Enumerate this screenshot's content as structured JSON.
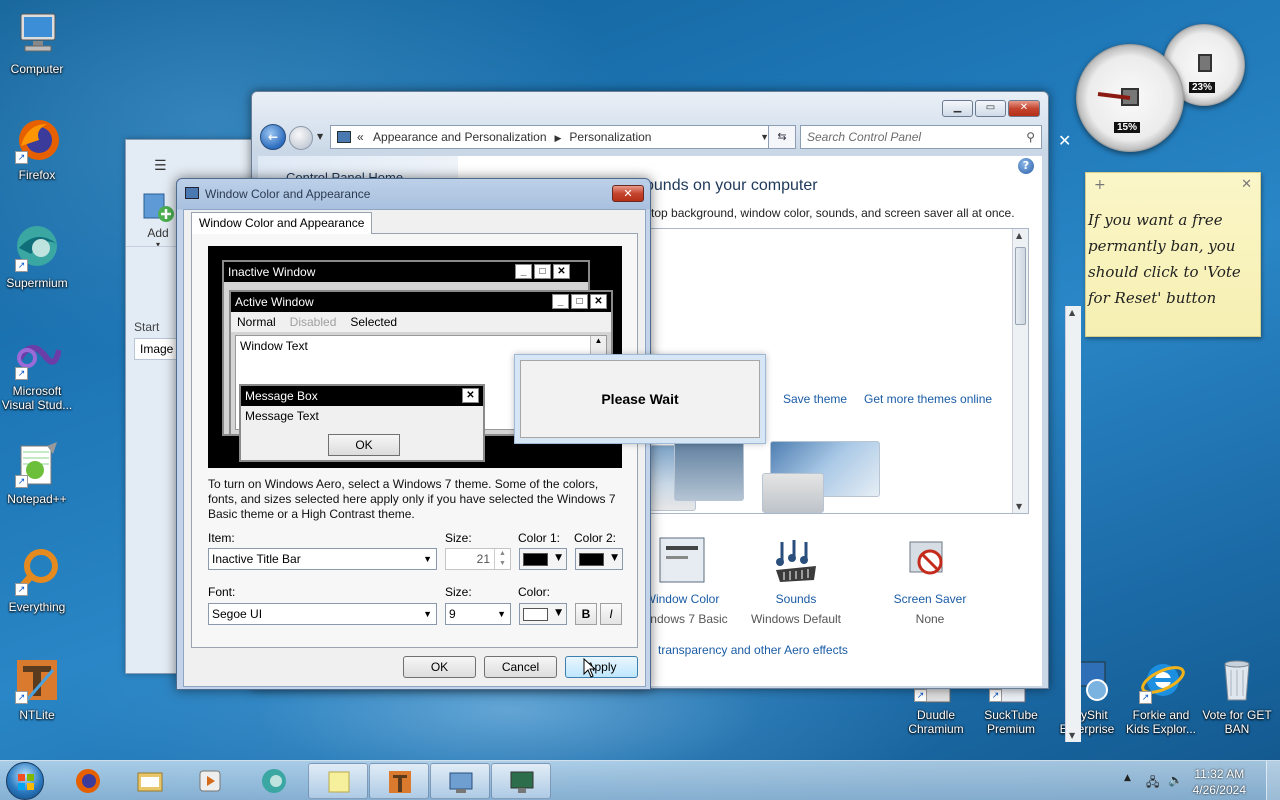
{
  "desktop": {
    "icons_left": [
      {
        "label": "Computer"
      },
      {
        "label": "Firefox"
      },
      {
        "label": "Supermium"
      },
      {
        "label": "Microsoft Visual Stud..."
      },
      {
        "label": "Notepad++"
      },
      {
        "label": "Everything"
      },
      {
        "label": "NTLite"
      }
    ],
    "icons_bottom": [
      {
        "label": "Duudle Chramium"
      },
      {
        "label": "SuckTube Premium"
      },
      {
        "label": "AnyShit Enterprise"
      },
      {
        "label": "Forkie and Kids Explor..."
      },
      {
        "label": "Vote for GET BAN"
      }
    ]
  },
  "back_window": {
    "menu_icon": "hamburger-icon",
    "add_label": "Add",
    "start_label": "Start",
    "image_label": "Image"
  },
  "explorer": {
    "address": {
      "prefix": "«",
      "crumb1": "Appearance and Personalization",
      "crumb2": "Personalization"
    },
    "search_placeholder": "Search Control Panel",
    "left_title": "Control Panel Home",
    "heading": "ounds on your computer",
    "subheading": "ktop background, window color, sounds, and screen saver all at once.",
    "save_theme": "Save theme",
    "more_themes": "Get more themes online",
    "items": [
      {
        "title": "Window Color",
        "sub": "Windows 7 Basic"
      },
      {
        "title": "Sounds",
        "sub": "Windows Default"
      },
      {
        "title": "Screen Saver",
        "sub": "None"
      }
    ],
    "aero_link": "transparency and other Aero effects",
    "close_x": "✕"
  },
  "dialog": {
    "title": "Window Color and Appearance",
    "tab": "Window Color and Appearance",
    "preview": {
      "inactive_title": "Inactive Window",
      "active_title": "Active Window",
      "menu_normal": "Normal",
      "menu_disabled": "Disabled",
      "menu_selected": "Selected",
      "window_text": "Window Text",
      "msgbox_title": "Message Box",
      "msgbox_text": "Message Text",
      "msgbox_ok": "OK"
    },
    "description": "To turn on Windows Aero, select a Windows 7 theme.  Some of the colors, fonts, and sizes selected here apply only if you have selected the Windows 7 Basic theme or a High Contrast theme.",
    "item_label": "Item:",
    "item_value": "Inactive Title Bar",
    "size_label": "Size:",
    "size_value": "21",
    "color1_label": "Color 1:",
    "color2_label": "Color 2:",
    "color1": "#000000",
    "color2": "#000000",
    "font_label": "Font:",
    "font_value": "Segoe UI",
    "font_size_label": "Size:",
    "font_size_value": "9",
    "font_color_label": "Color:",
    "font_color": "#ffffff",
    "bold": "B",
    "italic": "I",
    "ok": "OK",
    "cancel": "Cancel",
    "apply": "Apply"
  },
  "wait_box": {
    "text": "Please Wait"
  },
  "sticky_note": {
    "plus": "+",
    "close": "✕",
    "text": "If you want a free permantly ban, you should click to 'Vote for Reset' button"
  },
  "gadget": {
    "cpu_pct": "15%",
    "mem_pct": "23%"
  },
  "taskbar": {
    "time": "11:32 AM",
    "date": "4/26/2024"
  },
  "colors": {
    "accent": "#1a5ca6",
    "close_red": "#c4452f",
    "note_yellow": "#fbf6c8"
  }
}
